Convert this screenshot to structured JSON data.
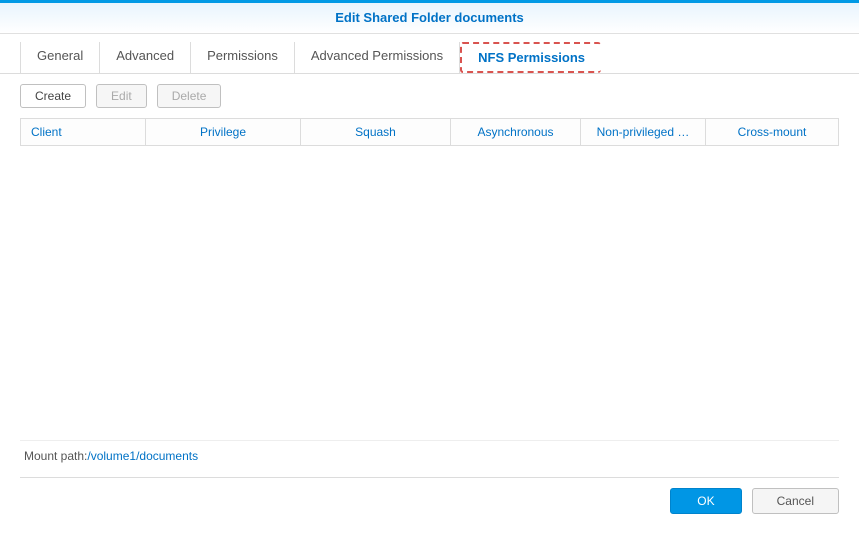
{
  "title": "Edit Shared Folder documents",
  "tabs": {
    "general": "General",
    "advanced": "Advanced",
    "permissions": "Permissions",
    "advanced_permissions": "Advanced Permissions",
    "nfs_permissions": "NFS Permissions"
  },
  "toolbar": {
    "create": "Create",
    "edit": "Edit",
    "delete": "Delete"
  },
  "columns": {
    "client": "Client",
    "privilege": "Privilege",
    "squash": "Squash",
    "asynchronous": "Asynchronous",
    "non_privileged": "Non-privileged …",
    "cross_mount": "Cross-mount"
  },
  "footer": {
    "mount_label": "Mount path:",
    "mount_path": "/volume1/documents",
    "ok": "OK",
    "cancel": "Cancel"
  }
}
